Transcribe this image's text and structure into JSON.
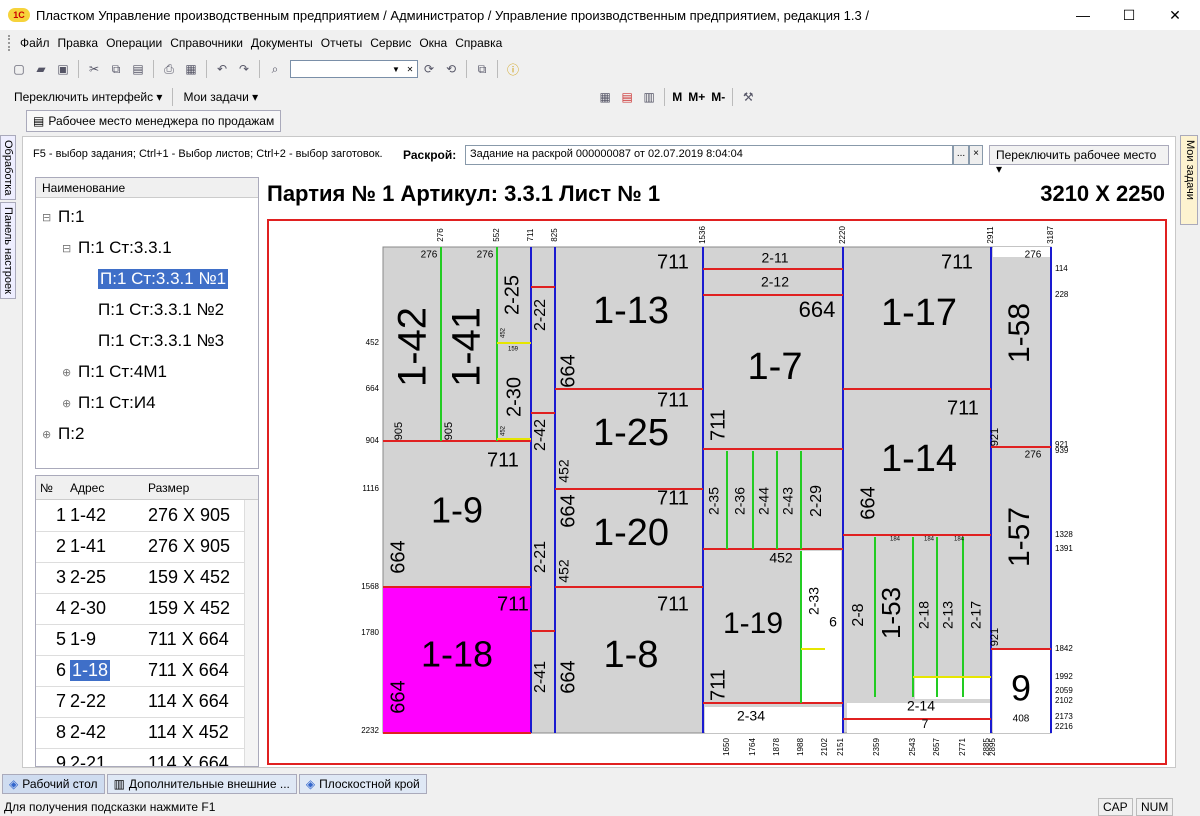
{
  "window": {
    "title": "Пластком Управление производственным предприятием / Администратор /  Управление производственным предприятием, редакция 1.3 /",
    "logo_text": "1С",
    "minimize": "—",
    "maximize": "☐",
    "close": "✕"
  },
  "menu": [
    "Файл",
    "Правка",
    "Операции",
    "Справочники",
    "Документы",
    "Отчеты",
    "Сервис",
    "Окна",
    "Справка"
  ],
  "toolbar2": {
    "switch_interface": "Переключить интерфейс ▾",
    "my_tasks": "Мои задачи ▾",
    "m": "M",
    "m_plus": "M+",
    "m_minus": "M-"
  },
  "workplace_button": "Рабочее место менеджера по продажам",
  "left_strip": [
    "Обработка",
    "Панель настроек"
  ],
  "right_strip": "Мои задачи",
  "hint": "F5 - выбор задания; Ctrl+1 - Выбор листов; Ctrl+2 - выбор заготовок.",
  "raskroj": {
    "label": "Раскрой:",
    "value": "Задание на раскрой 000000087 от 02.07.2019 8:04:04",
    "btn_select": "...",
    "btn_clear": "×"
  },
  "switch_workplace": "Переключить рабочее место ▾",
  "tree": {
    "header": "Наименование",
    "nodes": [
      {
        "label": "П:1",
        "pm": "⊟"
      },
      {
        "label": "П:1 Ст:3.3.1",
        "pm": "⊟"
      },
      {
        "label": "П:1 Ст:3.3.1 №1",
        "pm": ""
      },
      {
        "label": "П:1 Ст:3.3.1 №2",
        "pm": ""
      },
      {
        "label": "П:1 Ст:3.3.1 №3",
        "pm": ""
      },
      {
        "label": "П:1 Ст:4М1",
        "pm": "⊕"
      },
      {
        "label": "П:1 Ст:И4",
        "pm": "⊕"
      },
      {
        "label": "П:2",
        "pm": "⊕"
      }
    ]
  },
  "grid": {
    "headers": [
      "№",
      "Адрес",
      "Размер"
    ],
    "rows": [
      {
        "n": "1",
        "addr": "1-42",
        "size": "276 X 905"
      },
      {
        "n": "2",
        "addr": "1-41",
        "size": "276 X 905"
      },
      {
        "n": "3",
        "addr": "2-25",
        "size": "159 X 452"
      },
      {
        "n": "4",
        "addr": "2-30",
        "size": "159 X 452"
      },
      {
        "n": "5",
        "addr": "1-9",
        "size": "711 X 664"
      },
      {
        "n": "6",
        "addr": "1-18",
        "size": "711 X 664"
      },
      {
        "n": "7",
        "addr": "2-22",
        "size": "114 X 664"
      },
      {
        "n": "8",
        "addr": "2-42",
        "size": "114 X 452"
      },
      {
        "n": "9",
        "addr": "2-21",
        "size": "114 X 664"
      }
    ]
  },
  "sheet": {
    "title": "Партия № 1 Артикул: 3.3.1 Лист № 1",
    "size": "3210 X 2250"
  },
  "cut_top_ticks": [
    "276",
    "552",
    "711",
    "825",
    "1536",
    "2220",
    "2911",
    "3187"
  ],
  "cut_left_ticks": [
    "452",
    "664",
    "904",
    "1116",
    "1568",
    "1780",
    "2232"
  ],
  "cut_bottom_ticks": [
    "1650",
    "1764",
    "1878",
    "1988",
    "2102",
    "2151",
    "2359",
    "2543",
    "2657",
    "2771",
    "2885",
    "2895"
  ],
  "cut_right_ticks": [
    "114",
    "228",
    "921",
    "939",
    "1328",
    "1391",
    "1842",
    "1992",
    "2059",
    "2102",
    "2173",
    "2216"
  ],
  "pieces": [
    {
      "id": "1-42",
      "big": true,
      "vertical": true
    },
    {
      "id": "1-41",
      "big": true,
      "vertical": true
    },
    {
      "id": "2-25",
      "vertical": true
    },
    {
      "id": "2-30",
      "vertical": true
    },
    {
      "id": "2-22",
      "vertical": true
    },
    {
      "id": "2-42",
      "vertical": true
    },
    {
      "id": "2-21",
      "vertical": true
    },
    {
      "id": "2-41",
      "vertical": true
    },
    {
      "id": "1-9",
      "big": true
    },
    {
      "id": "1-18",
      "big": true,
      "highlight": true
    },
    {
      "id": "1-13",
      "big": true
    },
    {
      "id": "1-25",
      "big": true
    },
    {
      "id": "1-20",
      "big": true
    },
    {
      "id": "1-8",
      "big": true
    },
    {
      "id": "2-11"
    },
    {
      "id": "2-12"
    },
    {
      "id": "1-7",
      "big": true
    },
    {
      "id": "2-35",
      "vertical": true
    },
    {
      "id": "2-36",
      "vertical": true
    },
    {
      "id": "2-44",
      "vertical": true
    },
    {
      "id": "2-43",
      "vertical": true
    },
    {
      "id": "2-29",
      "vertical": true
    },
    {
      "id": "1-19",
      "big": true
    },
    {
      "id": "2-33",
      "vertical": true
    },
    {
      "id": "2-34"
    },
    {
      "id": "1-17",
      "big": true
    },
    {
      "id": "1-14",
      "big": true
    },
    {
      "id": "2-8",
      "vertical": true
    },
    {
      "id": "1-53",
      "big": true,
      "vertical": true
    },
    {
      "id": "2-18",
      "vertical": true
    },
    {
      "id": "2-13",
      "vertical": true
    },
    {
      "id": "2-17",
      "vertical": true
    },
    {
      "id": "2-14"
    },
    {
      "id": "1-58",
      "big": true,
      "vertical": true
    },
    {
      "id": "1-57",
      "big": true,
      "vertical": true
    }
  ],
  "dims": [
    "276",
    "276",
    "905",
    "905",
    "711",
    "711",
    "711",
    "711",
    "711",
    "711",
    "711",
    "711",
    "711",
    "711",
    "664",
    "664",
    "664",
    "664",
    "664",
    "664",
    "664",
    "452",
    "452",
    "452",
    "921",
    "921",
    "276",
    "276",
    "408",
    "6",
    "7",
    "9"
  ],
  "small_dims": [
    "159",
    "452",
    "452",
    "184",
    "184",
    "184"
  ],
  "taskbar": [
    "Рабочий стол",
    "Дополнительные внешние ...",
    "Плоскостной крой"
  ],
  "status": {
    "hint": "Для получения подсказки нажмите F1",
    "cap": "CAP",
    "num": "NUM"
  },
  "colors": {
    "highlight": "#ff00ff",
    "piece": "#d3d3d3",
    "cut_red": "#e02020",
    "cut_blue": "#1a1ad0",
    "cut_green": "#22cc22",
    "cut_yellow": "#e6e600",
    "selection": "#3f6fc8"
  }
}
